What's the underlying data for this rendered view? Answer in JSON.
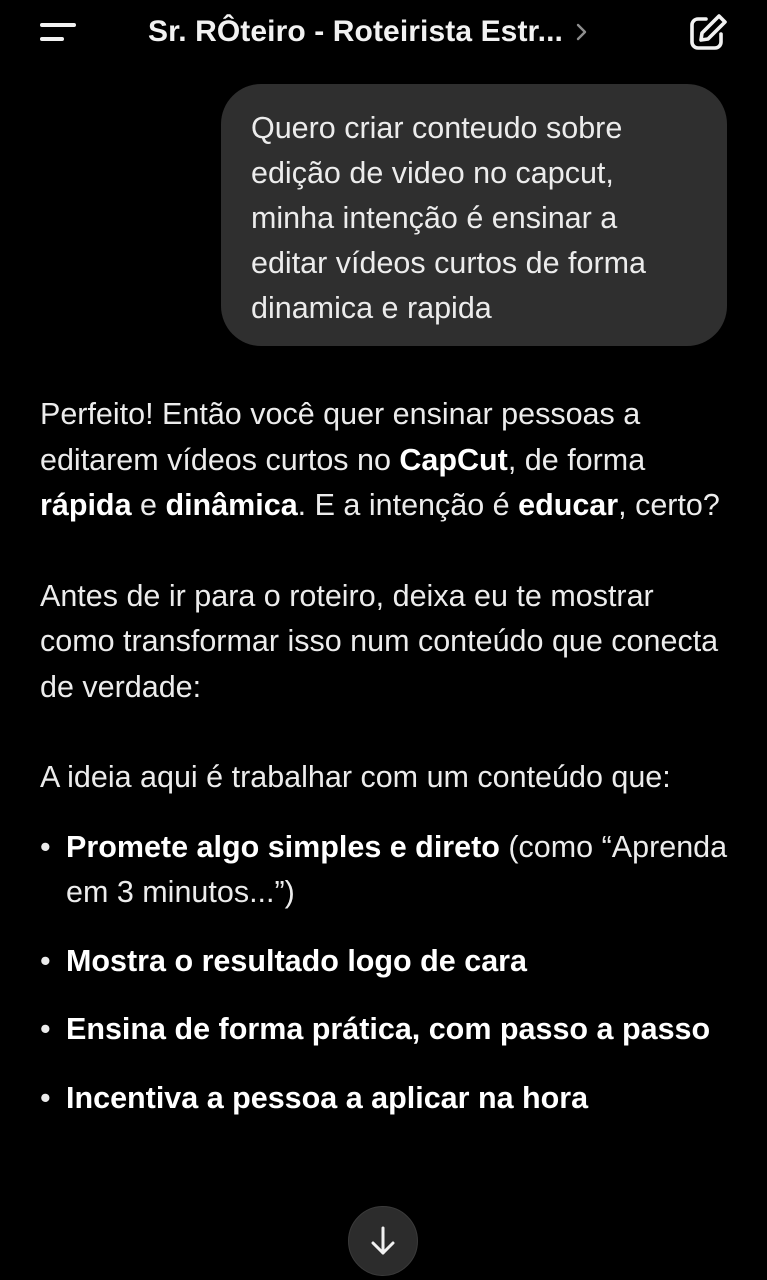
{
  "header": {
    "title": "Sr. RÔteiro - Roteirista Estr...",
    "menu_icon": "menu-icon",
    "chevron_icon": "chevron-right-icon",
    "compose_icon": "new-chat-icon"
  },
  "user_message": {
    "text": "Quero criar conteudo sobre edição de video no capcut, minha intenção é ensinar a editar vídeos curtos de forma dinamica e rapida"
  },
  "assistant_message": {
    "p1": {
      "t1": "Perfeito! Então você quer ensinar pessoas a editarem vídeos curtos no ",
      "b1": "CapCut",
      "t2": ", de forma ",
      "b2": "rápida",
      "t3": " e ",
      "b3": "dinâmica",
      "t4": ". E a intenção é ",
      "b4": "educar",
      "t5": ", certo?"
    },
    "p2": "Antes de ir para o roteiro, deixa eu te mostrar como transformar isso num conteúdo que conecta de verdade:",
    "p3": "A ideia aqui é trabalhar com um conteúdo que:",
    "bullets": [
      {
        "bold": "Promete algo simples e direto",
        "text": " (como “Aprenda em 3 minutos...”)"
      },
      {
        "bold": "Mostra o resultado logo de cara",
        "text": ""
      },
      {
        "bold": "Ensina de forma prática, com passo a passo",
        "text": ""
      },
      {
        "bold": "Incentiva a pessoa a aplicar na hora",
        "text": ""
      }
    ],
    "bullet_glyph": "•"
  },
  "scroll_button": {
    "icon": "arrow-down-icon"
  },
  "colors": {
    "background": "#000000",
    "bubble": "#2f2f2f",
    "text": "#ececec",
    "scroll_button": "#2c2c2c"
  }
}
